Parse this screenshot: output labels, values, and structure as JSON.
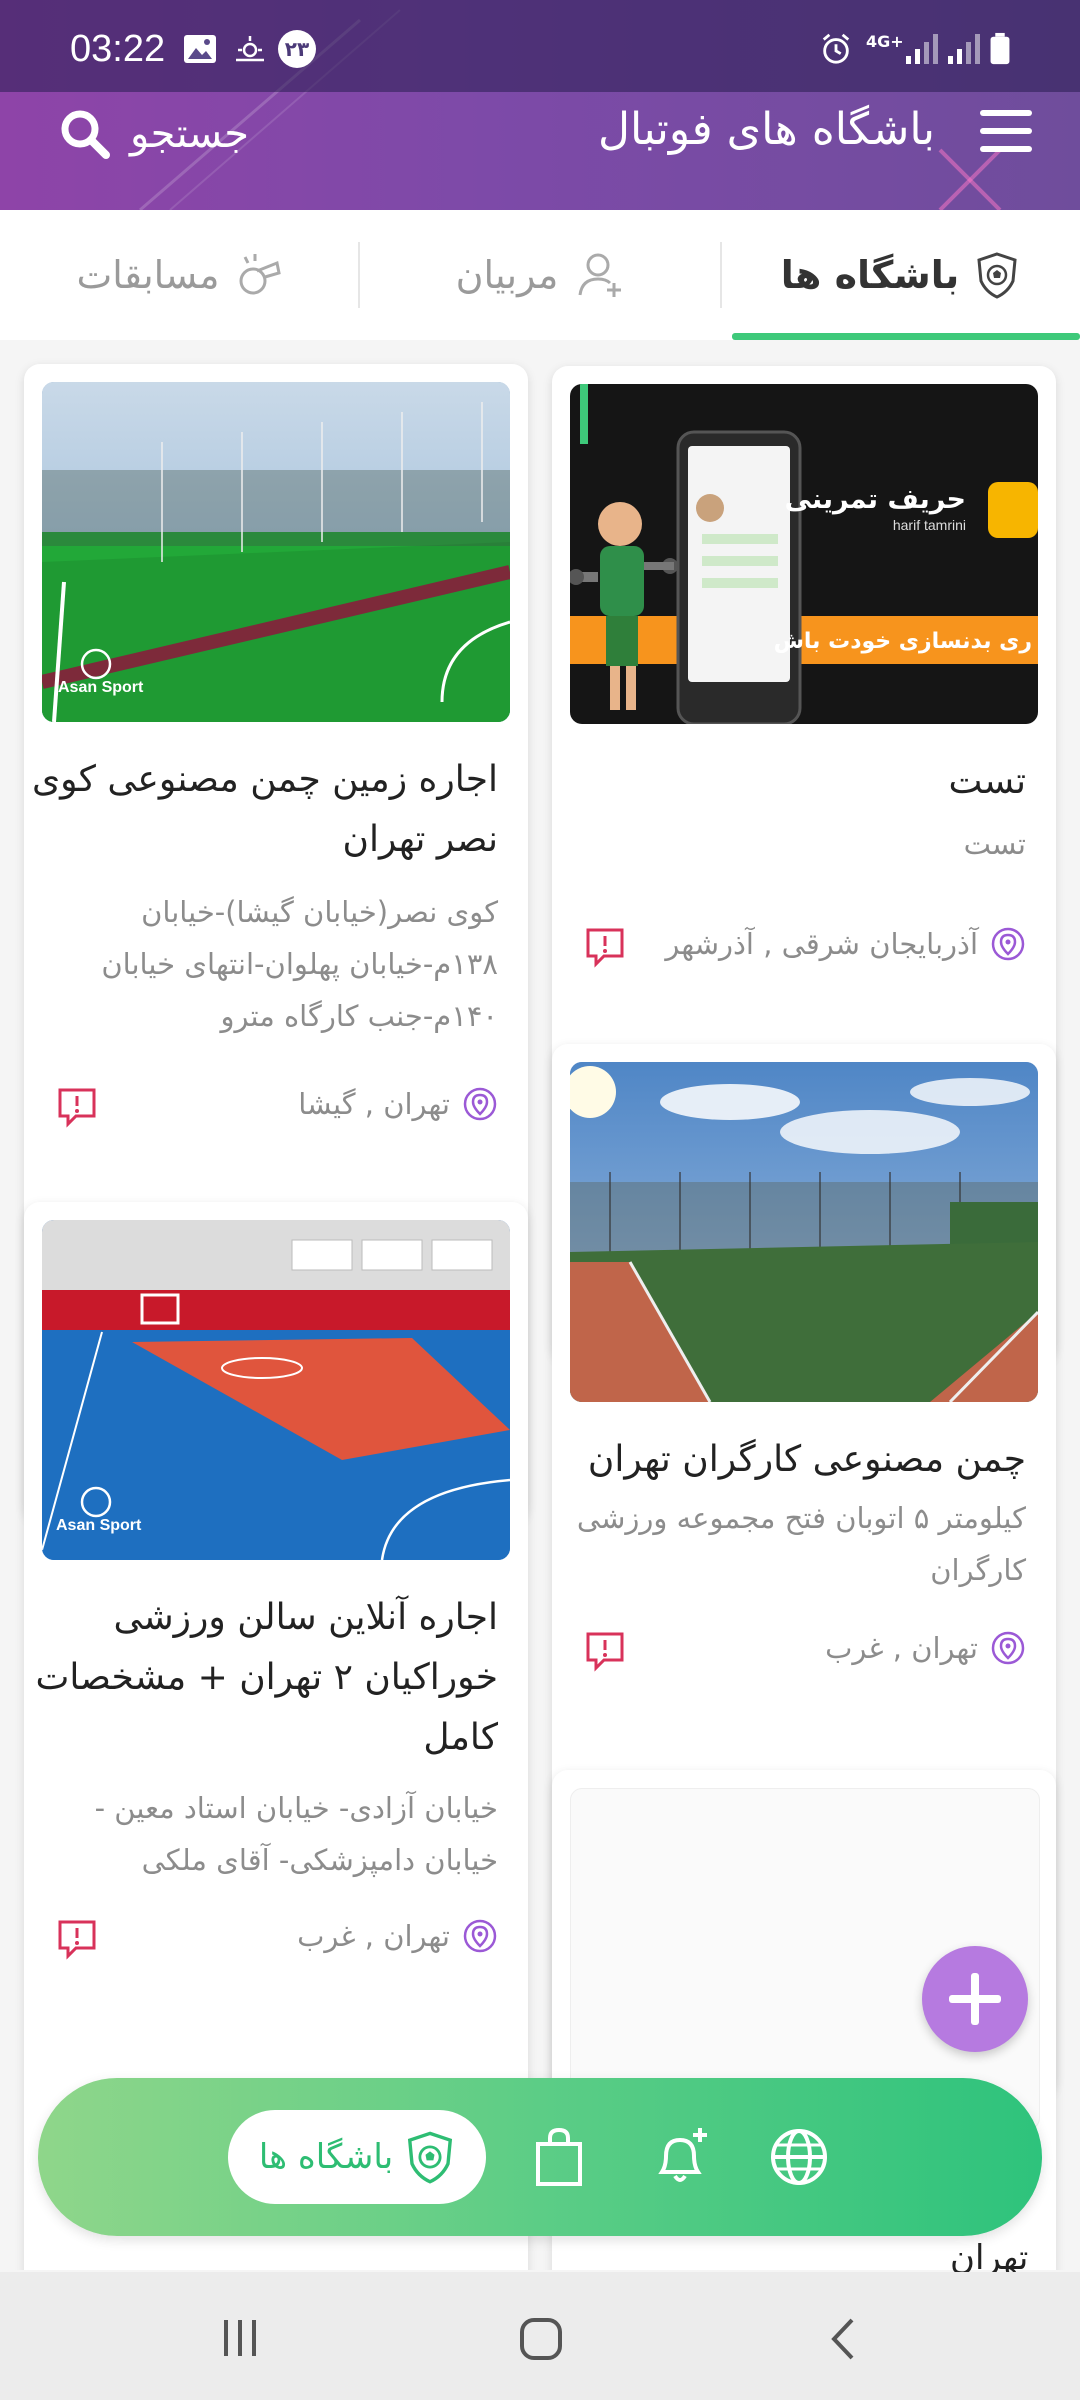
{
  "status": {
    "time": "03:22",
    "badge": "۲۳",
    "network": "4G+"
  },
  "header": {
    "title": "باشگاه های فوتبال",
    "search_label": "جستجو"
  },
  "tabs": [
    {
      "label": "باشگاه ها",
      "icon": "shield-icon",
      "active": true
    },
    {
      "label": "مربیان",
      "icon": "add-user-icon",
      "active": false
    },
    {
      "label": "مسابقات",
      "icon": "whistle-icon",
      "active": false
    }
  ],
  "cards": [
    {
      "title": "تست",
      "desc": "تست",
      "location": "آذربایجان شرقی , آذرشهر",
      "image": {
        "text_main": "حریف تمرینی",
        "text_sub": "harif tamrini",
        "banner": "ری بدنسازی خودت باش"
      }
    },
    {
      "title_lines": [
        "اجاره زمین چمن مصنوعی کوی",
        "نصر تهران"
      ],
      "desc_lines": [
        "کوی نصر(خیابان گیشا)-خیابان",
        "۱۳۸م-خیابان پهلوان-انتهای خیابان",
        "۱۴۰م-جنب کارگاه مترو"
      ],
      "location": "تهران , گیشا",
      "image": {
        "watermark": "Asan Sport"
      }
    },
    {
      "title": "چمن مصنوعی کارگران تهران",
      "desc_lines": [
        "کیلومتر ۵ اتوبان فتح مجموعه ورزشی",
        "کارگران"
      ],
      "location": "تهران , غرب"
    },
    {
      "title_lines": [
        "اجاره آنلاین سالن ورزشی",
        "خوراکیان ۲ تهران + مشخصات",
        "کامل"
      ],
      "desc_lines": [
        "خیابان آزادی- خیابان استاد معین -",
        "خیابان دامپزشکی- آقای ملکی"
      ],
      "location": "تهران , غرب",
      "image": {
        "watermark": "Asan Sport"
      }
    }
  ],
  "partial_card_text": "تهران",
  "bottom_nav": {
    "active_label": "باشگاه ها",
    "items": [
      "globe-icon",
      "bell-plus-icon",
      "shopping-bag-icon",
      "shield-icon"
    ]
  },
  "colors": {
    "accent_purple": "#8e44a8",
    "accent_green": "#3ec97a",
    "fab": "#b67ae0"
  }
}
